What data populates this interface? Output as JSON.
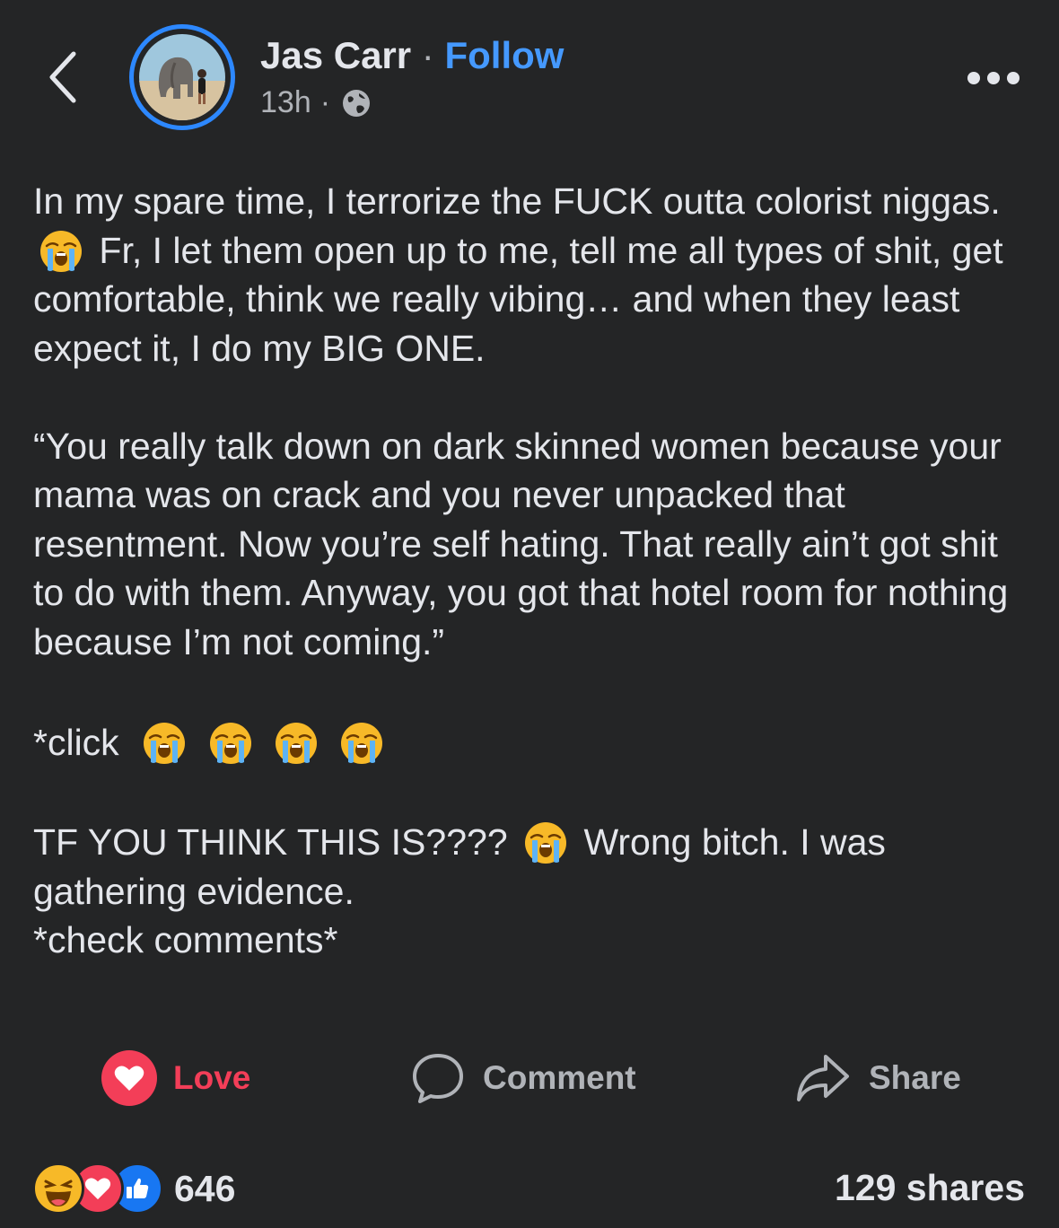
{
  "header": {
    "author_name": "Jas Carr",
    "separator": "·",
    "follow_label": "Follow",
    "time": "13h",
    "time_separator": "·",
    "audience_icon": "globe-icon",
    "back_icon": "chevron-left-icon",
    "more_icon": "more-horizontal-icon"
  },
  "post": {
    "p1_part1": "In my spare time, I terrorize the FUCK outta colorist niggas.",
    "p1_part2": "Fr, I let them open up to me, tell me all types of shit, get comfortable, think we really vibing… and when they least expect it, I do my BIG ONE.",
    "p2": "“You really talk down on dark skinned women because your mama was on crack and you never unpacked that resentment. Now you’re self hating. That really ain’t got shit to do with them. Anyway, you got that hotel room for nothing because I’m not coming.”",
    "p3": "*click",
    "p4_part1": "TF YOU THINK THIS IS????",
    "p4_part2": "Wrong bitch. I was gathering evidence.",
    "p5": "*check comments*",
    "emoji": "loudly-crying-face-icon"
  },
  "actions": {
    "love_label": "Love",
    "comment_label": "Comment",
    "share_label": "Share"
  },
  "footer": {
    "reaction_icons": [
      "haha-icon",
      "love-icon",
      "like-icon"
    ],
    "reaction_count": "646",
    "shares_text": "129 shares"
  },
  "colors": {
    "background": "#242526",
    "text": "#e4e6eb",
    "secondary_text": "#b0b3b8",
    "link_blue": "#4599ff",
    "love_red": "#f33e58",
    "like_blue": "#1877f2",
    "haha_yellow": "#f7b928"
  }
}
